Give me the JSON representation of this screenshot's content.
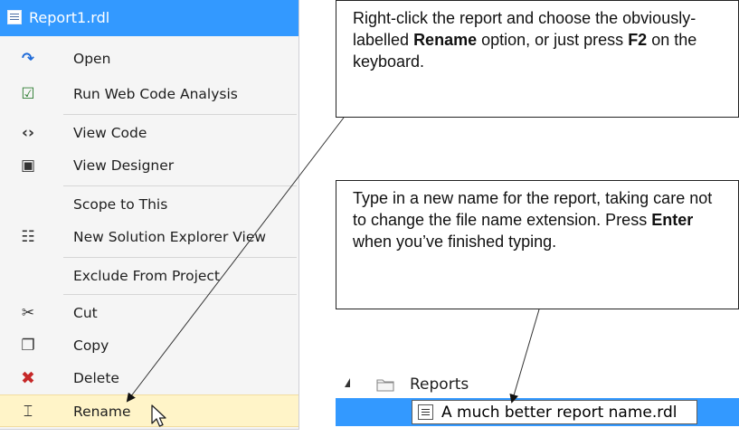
{
  "menu": {
    "title": "Report1.rdl",
    "items": [
      {
        "label": "Open",
        "icon": "open-arrow-icon",
        "glyph": "↷",
        "color": "#1e6ad8"
      },
      {
        "label": "Run Web Code Analysis",
        "icon": "code-analysis-icon",
        "glyph": "☑",
        "color": "#2e7d32"
      },
      {
        "label": "View Code",
        "icon": "view-code-icon",
        "glyph": "‹›",
        "color": "#333333"
      },
      {
        "label": "View Designer",
        "icon": "view-designer-icon",
        "glyph": "▣",
        "color": "#333333"
      },
      {
        "label": "Scope to This",
        "icon": "",
        "glyph": "",
        "color": "#333333"
      },
      {
        "label": "New Solution Explorer View",
        "icon": "new-view-icon",
        "glyph": "☷",
        "color": "#333333"
      },
      {
        "label": "Exclude From Project",
        "icon": "",
        "glyph": "",
        "color": "#333333"
      },
      {
        "label": "Cut",
        "icon": "scissors-icon",
        "glyph": "✂",
        "color": "#333333"
      },
      {
        "label": "Copy",
        "icon": "copy-icon",
        "glyph": "❐",
        "color": "#333333"
      },
      {
        "label": "Delete",
        "icon": "delete-x-icon",
        "glyph": "✖",
        "color": "#c62828"
      },
      {
        "label": "Rename",
        "icon": "rename-icon",
        "glyph": "⌶",
        "color": "#333333"
      }
    ]
  },
  "callout1": {
    "text_a": "Right-click the report and choose the obviously-labelled ",
    "bold_a": "Rename",
    "text_b": " option, or just press ",
    "bold_b": "F2",
    "text_c": " on the keyboard."
  },
  "callout2": {
    "text_a": "Type in a new name for the report, taking care not to change the file name extension.  Press ",
    "bold_a": "Enter",
    "text_b": " when you’ve finished typing."
  },
  "explorer": {
    "folder_label": "Reports",
    "rename_value": "A much better report name.rdl"
  },
  "colors": {
    "selection_blue": "#3399ff",
    "highlight_yellow": "#fff4c8",
    "menu_bg": "#f5f5f5"
  }
}
